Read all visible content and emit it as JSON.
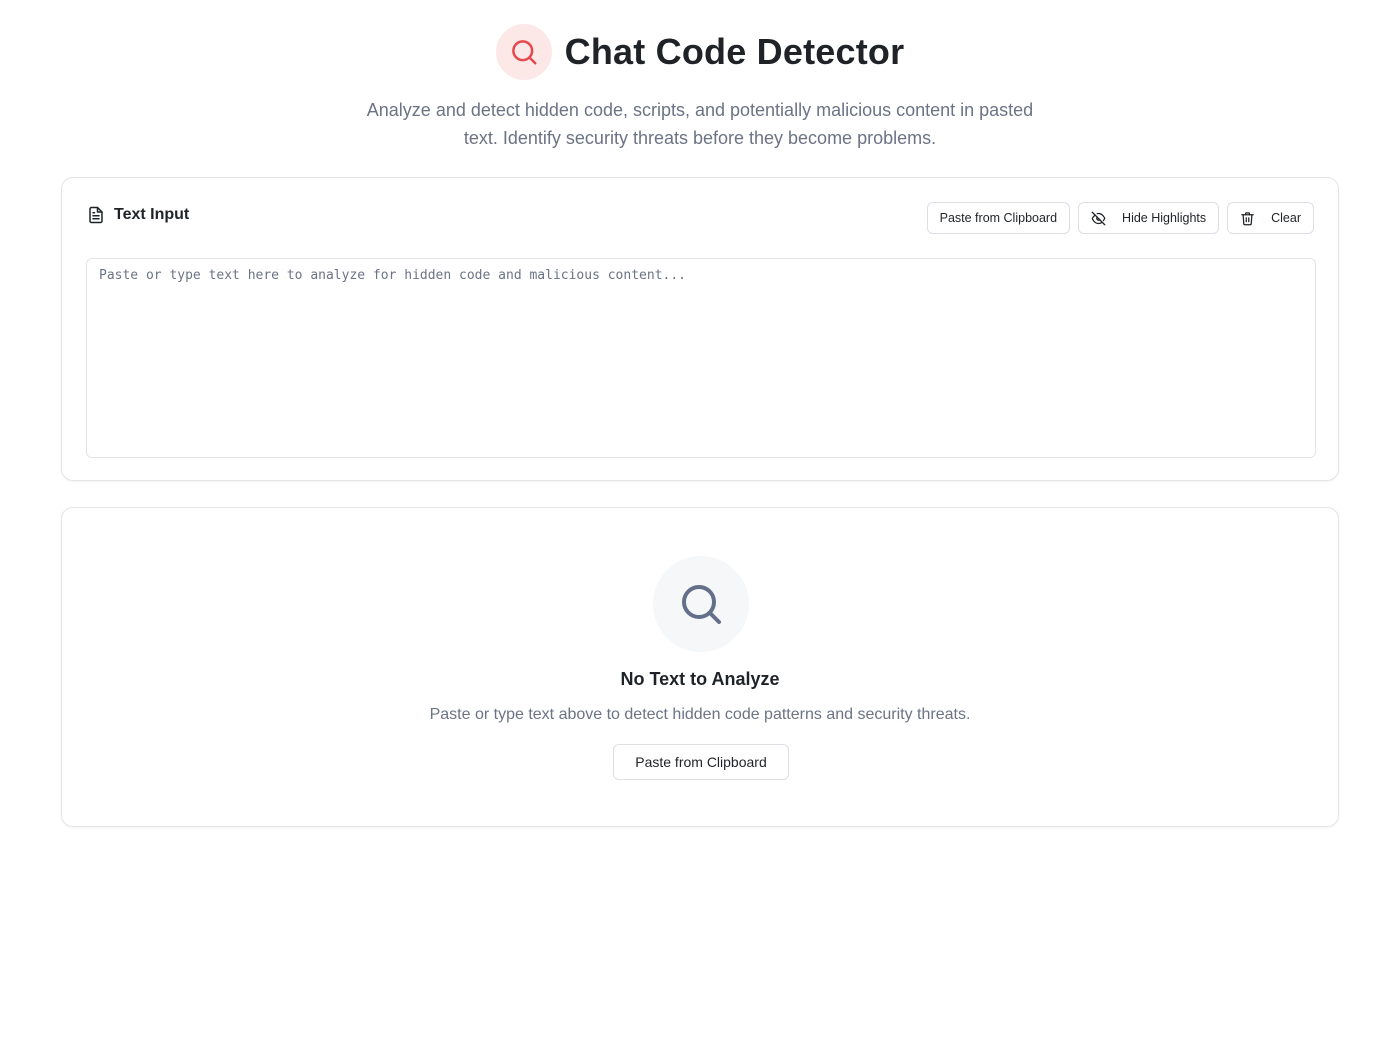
{
  "header": {
    "title": "Chat Code Detector",
    "subtitle": "Analyze and detect hidden code, scripts, and potentially malicious content in pasted text. Identify security threats before they become problems.",
    "logo_icon": "search-icon",
    "accent_color": "#e5484d"
  },
  "input_card": {
    "title": "Text Input",
    "title_icon": "document-icon",
    "buttons": {
      "paste_label": "Paste from Clipboard",
      "hide_highlights_label": "Hide Highlights",
      "hide_highlights_icon": "eye-off-icon",
      "clear_label": "Clear",
      "clear_icon": "trash-icon"
    },
    "textarea": {
      "value": "",
      "placeholder": "Paste or type text here to analyze for hidden code and malicious content..."
    }
  },
  "empty_state": {
    "icon": "search-icon",
    "title": "No Text to Analyze",
    "text": "Paste or type text above to detect hidden code patterns and security threats.",
    "button_label": "Paste from Clipboard"
  }
}
